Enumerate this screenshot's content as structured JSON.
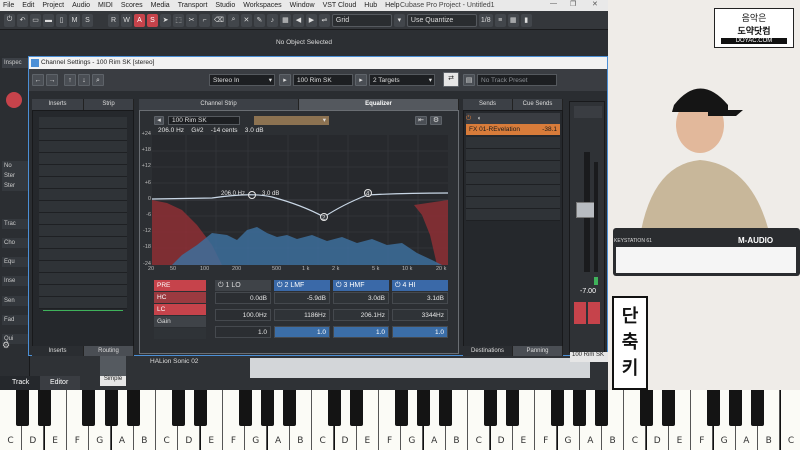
{
  "app": {
    "title": "Cubase Pro Project - Untitled1",
    "menus": [
      "File",
      "Edit",
      "Project",
      "Audio",
      "MIDI",
      "Scores",
      "Media",
      "Transport",
      "Studio",
      "Workspaces",
      "Window",
      "VST Cloud",
      "Hub",
      "Help"
    ]
  },
  "toolbar": {
    "m_label": "M",
    "s_label": "S",
    "r_label": "R",
    "w_label": "W",
    "a_label": "A",
    "s2_label": "S",
    "grid_label": "Grid",
    "quantize_label": "Use Quantize",
    "quant_value": "1/8"
  },
  "status": {
    "text": "No Object Selected"
  },
  "inspector": {
    "title": "Inspec",
    "items": [
      "No",
      "Ster",
      "Ster",
      "Trac",
      "Cho",
      "Equ",
      "Inse",
      "Sen",
      "Fad",
      "Qui"
    ]
  },
  "channel_settings": {
    "title": "Channel Settings - 100 Rim SK [stereo]",
    "routing_in": "Stereo In",
    "channel_name": "100 Rim SK",
    "targets": "2 Targets",
    "track_preset": "No Track Preset",
    "tabs": {
      "inserts": "Inserts",
      "strip": "Strip",
      "channel_strip": "Channel Strip",
      "equalizer": "Equalizer",
      "sends": "Sends",
      "cue_sends": "Cue Sends"
    },
    "bottom_tabs": {
      "inserts": "Inserts",
      "routing": "Routing",
      "destinations": "Destinations",
      "panning": "Panning"
    }
  },
  "eq": {
    "preset_name": "100 Rim SK",
    "readout_freq": "206.0 Hz",
    "readout_note": "G#2",
    "readout_cents": "-14 cents",
    "readout_db": "3.0 dB",
    "hover_freq": "206.0 Hz",
    "hover_db": "3.0 dB",
    "db_ticks": [
      "+24",
      "+18",
      "+12",
      "+6",
      "0",
      "-6",
      "-12",
      "-18",
      "-24"
    ],
    "freq_ticks": [
      "20",
      "50",
      "100",
      "200",
      "500",
      "1 k",
      "2 k",
      "5 k",
      "10 k",
      "20 k"
    ],
    "node_labels": [
      "2",
      "3",
      "4"
    ],
    "controls": {
      "pre": "PRE",
      "hc": "HC",
      "lc": "LC",
      "gain": "Gain"
    },
    "bands": [
      {
        "label": "1 LO",
        "gain": "0.0dB",
        "freq": "100.0Hz",
        "q": "1.0",
        "on": false
      },
      {
        "label": "2 LMF",
        "gain": "-5.9dB",
        "freq": "1186Hz",
        "q": "1.0",
        "on": true
      },
      {
        "label": "3 HMF",
        "gain": "3.0dB",
        "freq": "206.1Hz",
        "q": "1.0",
        "on": true
      },
      {
        "label": "4 HI",
        "gain": "3.1dB",
        "freq": "3344Hz",
        "q": "1.0",
        "on": true
      }
    ]
  },
  "sends": {
    "items": [
      {
        "name": "FX 01-REvelation",
        "level": "-38.1"
      }
    ]
  },
  "mixer": {
    "fader_value": "-7.00",
    "channel_label": "100 Rim SK"
  },
  "lower": {
    "track_tab": "Track",
    "editor_tab": "Editor",
    "instrument": "HALion Sonic 02",
    "mode": "Simple"
  },
  "overlay": {
    "logo_line1": "음악은",
    "logo_line2": "도약닷컴",
    "logo_url": "DOYAC.COM",
    "caption_1": "단",
    "caption_2": "축",
    "caption_3": "키",
    "keyboard_brand": "M-AUDIO",
    "keyboard_model": "KEYSTATION 61"
  },
  "piano": {
    "notes": [
      "C",
      "D",
      "E",
      "F",
      "G",
      "A",
      "B",
      "C",
      "D",
      "E",
      "F",
      "G",
      "A",
      "B",
      "C",
      "D",
      "E",
      "F",
      "G",
      "A",
      "B",
      "C",
      "D",
      "E",
      "F",
      "G",
      "A",
      "B",
      "C",
      "D",
      "E",
      "F",
      "G",
      "A",
      "B",
      "C"
    ]
  },
  "colors": {
    "accent": "#3b6ea8",
    "lowcut": "#c6434b",
    "sends_orange": "#d87c3a"
  }
}
